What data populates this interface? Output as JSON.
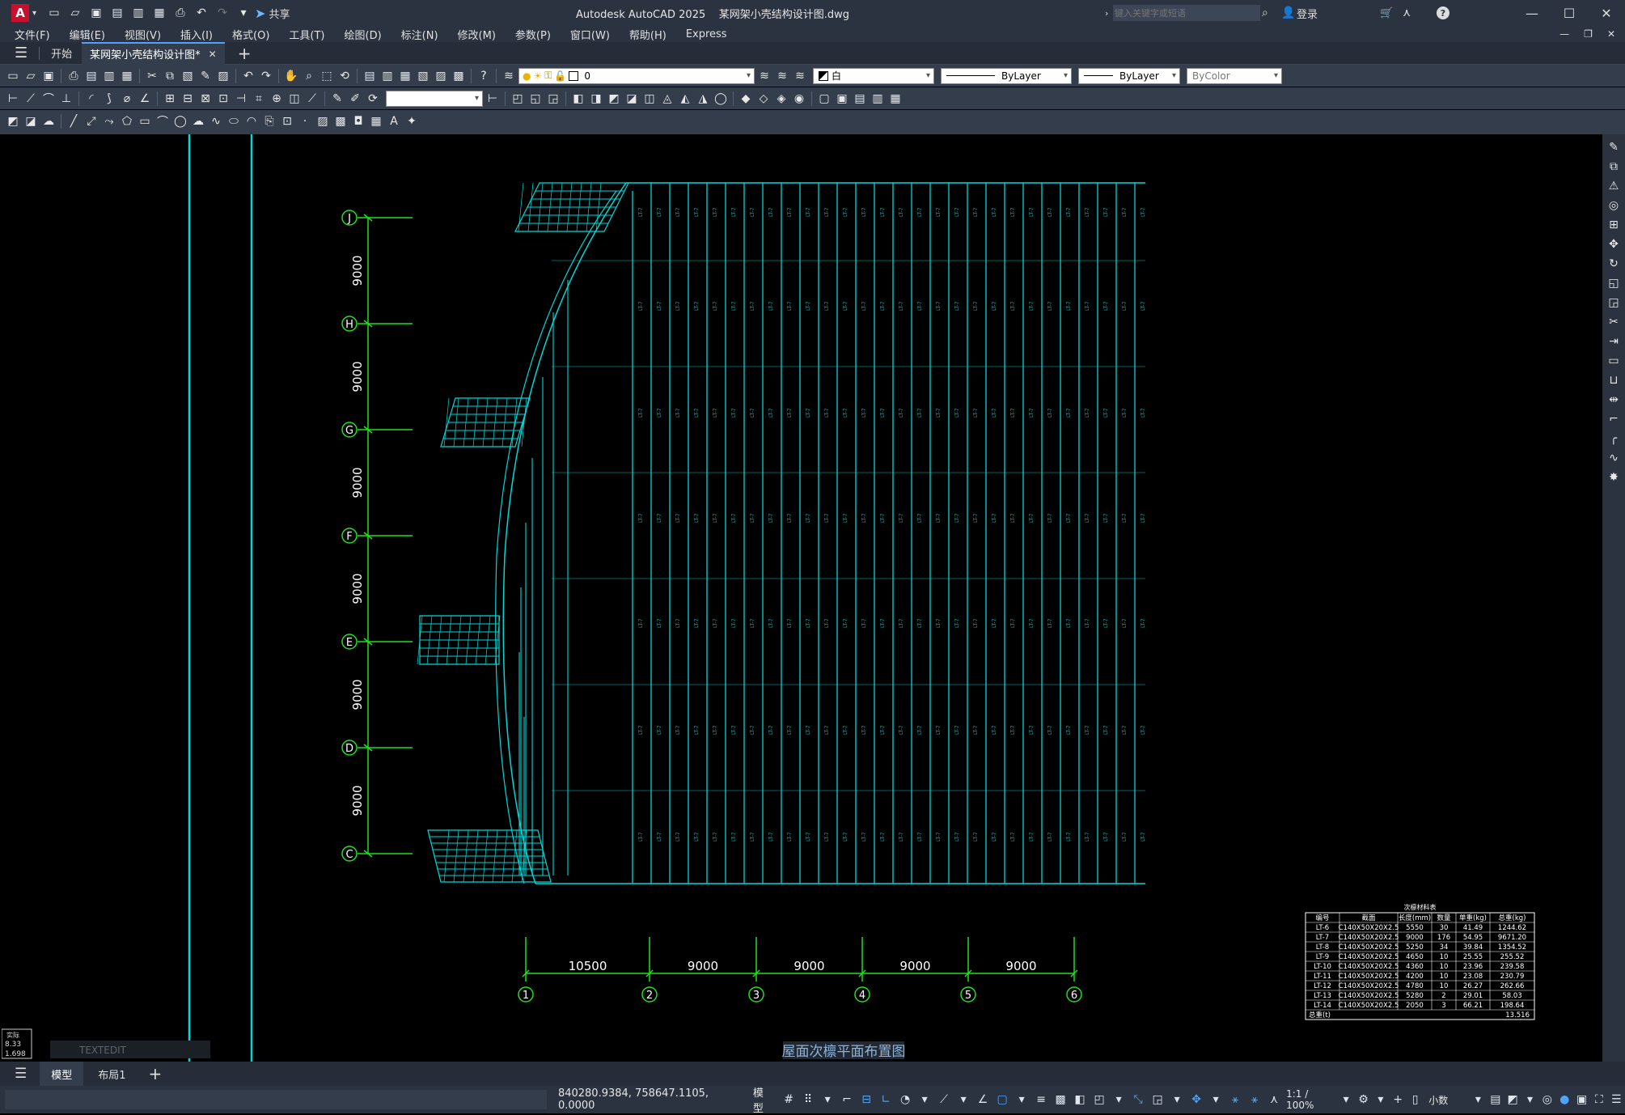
{
  "app": {
    "title": "Autodesk AutoCAD 2025    某网架小壳结构设计图.dwg",
    "share_label": "共享",
    "search_placeholder": "键入关键字或短语",
    "login_label": "登录"
  },
  "menus": [
    "文件(F)",
    "编辑(E)",
    "视图(V)",
    "插入(I)",
    "格式(O)",
    "工具(T)",
    "绘图(D)",
    "标注(N)",
    "修改(M)",
    "参数(P)",
    "窗口(W)",
    "帮助(H)",
    "Express"
  ],
  "doc_tabs": {
    "start": "开始",
    "active": "某网架小壳结构设计图*"
  },
  "properties": {
    "layer": "0",
    "color": "白",
    "linetype": "ByLayer",
    "lineweight": "ByLayer",
    "plotstyle": "ByColor"
  },
  "grid_rows": [
    "J",
    "H",
    "G",
    "F",
    "E",
    "D",
    "C"
  ],
  "row_spacing": "9000",
  "grid_cols": [
    "1",
    "2",
    "3",
    "4",
    "5",
    "6"
  ],
  "col_spacings": [
    "10500",
    "9000",
    "9000",
    "9000",
    "9000"
  ],
  "beam_label": "LT-7",
  "drawing_title": "屋面次檩平面布置图",
  "table": {
    "title": "次檩材料表",
    "headers": [
      "编号",
      "截面",
      "长度(mm)",
      "数量",
      "单重(kg)",
      "总重(kg)"
    ],
    "rows": [
      [
        "LT-6",
        "C140X50X20X2.5",
        "5550",
        "30",
        "41.49",
        "1244.62"
      ],
      [
        "LT-7",
        "C140X50X20X2.5",
        "9000",
        "176",
        "54.95",
        "9671.20"
      ],
      [
        "LT-8",
        "C140X50X20X2.5",
        "5250",
        "34",
        "39.84",
        "1354.52"
      ],
      [
        "LT-9",
        "C140X50X20X2.5",
        "4650",
        "10",
        "25.55",
        "255.52"
      ],
      [
        "LT-10",
        "C140X50X20X2.5",
        "4360",
        "10",
        "23.96",
        "239.58"
      ],
      [
        "LT-11",
        "C140X50X20X2.5",
        "4200",
        "10",
        "23.08",
        "230.79"
      ],
      [
        "LT-12",
        "C140X50X20X2.5",
        "4780",
        "10",
        "26.27",
        "262.66"
      ],
      [
        "LT-13",
        "C140X50X20X2.5",
        "5280",
        "2",
        "29.01",
        "58.03"
      ],
      [
        "LT-14",
        "C140X50X20X2.5",
        "2050",
        "3",
        "66.21",
        "198.64"
      ]
    ],
    "total_label": "总重(t)",
    "total_value": "13.516"
  },
  "command_overlay": "TEXTEDIT",
  "mini_panel": [
    "实际",
    "8.33",
    "1.698"
  ],
  "layout_tabs": [
    "模型",
    "布局1"
  ],
  "status": {
    "coords": "840280.9384, 758647.1105, 0.0000",
    "model_label": "模型",
    "scale": "1:1 / 100%",
    "units": "小数"
  }
}
